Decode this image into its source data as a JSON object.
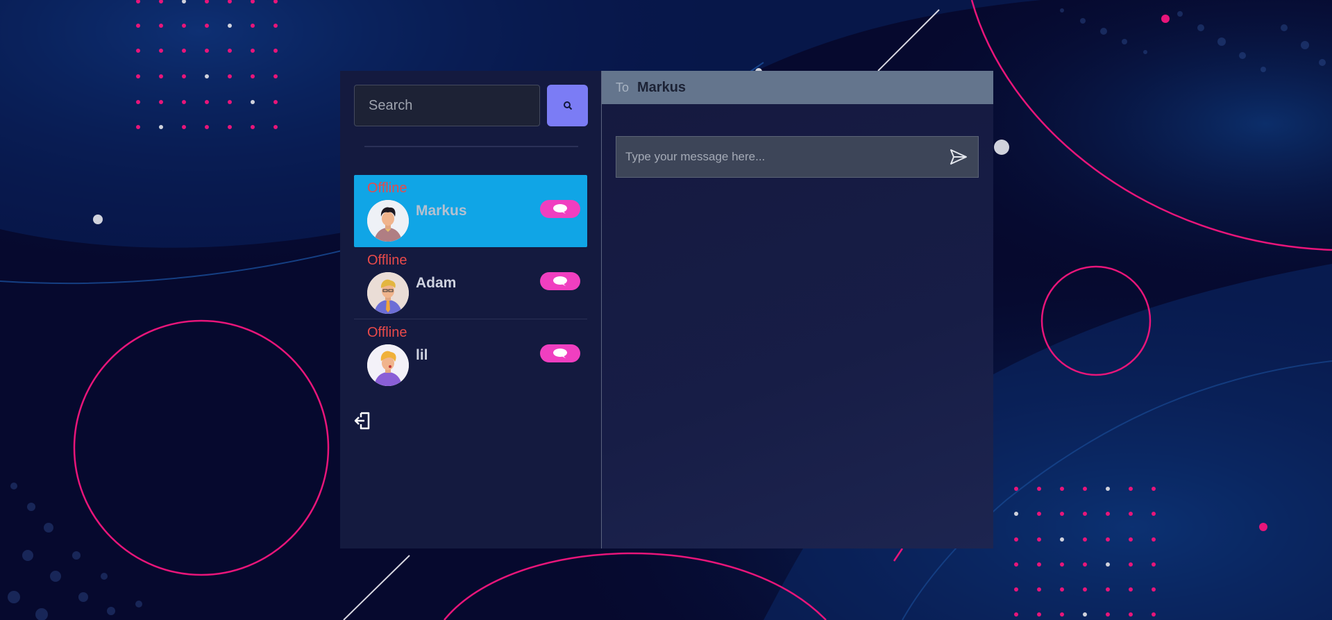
{
  "search": {
    "placeholder": "Search",
    "button_icon": "search-icon"
  },
  "contacts": [
    {
      "name": "Markus",
      "status": "Offline",
      "active": true,
      "action_icon": "chat-bubble-icon"
    },
    {
      "name": "Adam",
      "status": "Offline",
      "active": false,
      "action_icon": "chat-bubble-icon"
    },
    {
      "name": "lil",
      "status": "Offline",
      "active": false,
      "action_icon": "chat-bubble-icon"
    }
  ],
  "sidebar": {
    "logout_icon": "logout-icon"
  },
  "chat": {
    "to_label": "To",
    "recipient": "Markus",
    "message_placeholder": "Type your message here...",
    "send_icon": "send-icon"
  },
  "colors": {
    "background": "#06092e",
    "accent_pink": "#e8157a",
    "active_contact": "#10a5e6",
    "search_button": "#7b7cf5",
    "chat_toggle": "#f03fc0",
    "status_offline": "#e84a4a",
    "header": "#64758d"
  }
}
